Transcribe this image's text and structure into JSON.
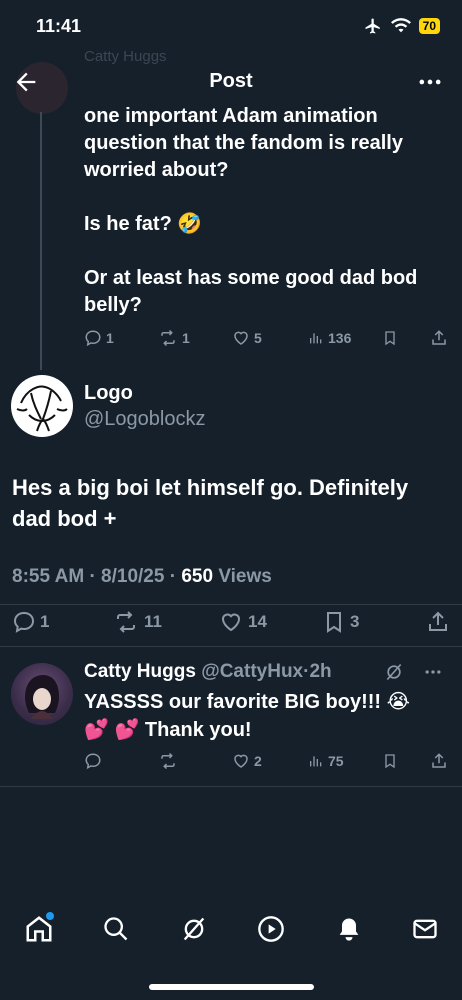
{
  "status_bar": {
    "time": "11:41",
    "battery": "70"
  },
  "header": {
    "title": "Post"
  },
  "faded_row": {
    "text": "Catty Huggs"
  },
  "parent_post": {
    "text": "one important Adam animation question that the fandom is really worried about?\n\nIs he fat? 🤣\n\nOr at least has some good dad bod belly?",
    "replies": "1",
    "reposts": "1",
    "likes": "5",
    "views": "136"
  },
  "main_post": {
    "author_name": "Logo",
    "author_handle": "@Logoblockz",
    "text": "Hes a big boi let himself go. Definitely dad bod +",
    "time": "8:55 AM",
    "date": "8/10/25",
    "views_count": "650",
    "views_label": "Views",
    "replies": "1",
    "reposts": "11",
    "likes": "14",
    "bookmarks": "3"
  },
  "reply": {
    "author_name": "Catty Huggs",
    "author_handle": "@CattyHux",
    "age": "2h",
    "text": "YASSSS our favorite BIG boy!!! 😭 💕 💕 Thank you!",
    "likes": "2",
    "views": "75"
  },
  "icons": {
    "back": "arrow-left-icon",
    "more": "more-horizontal-icon",
    "reply": "speech-bubble-icon",
    "repost": "repost-arrows-icon",
    "like": "heart-icon",
    "views": "bar-chart-icon",
    "bookmark": "bookmark-icon",
    "share": "share-upload-icon",
    "tabs": [
      "home-icon",
      "search-icon",
      "grok-icon",
      "play-icon",
      "bell-icon",
      "mail-icon"
    ]
  },
  "colors": {
    "background": "#15202b",
    "muted": "#8b98a5",
    "accent": "#1d9bf0"
  }
}
